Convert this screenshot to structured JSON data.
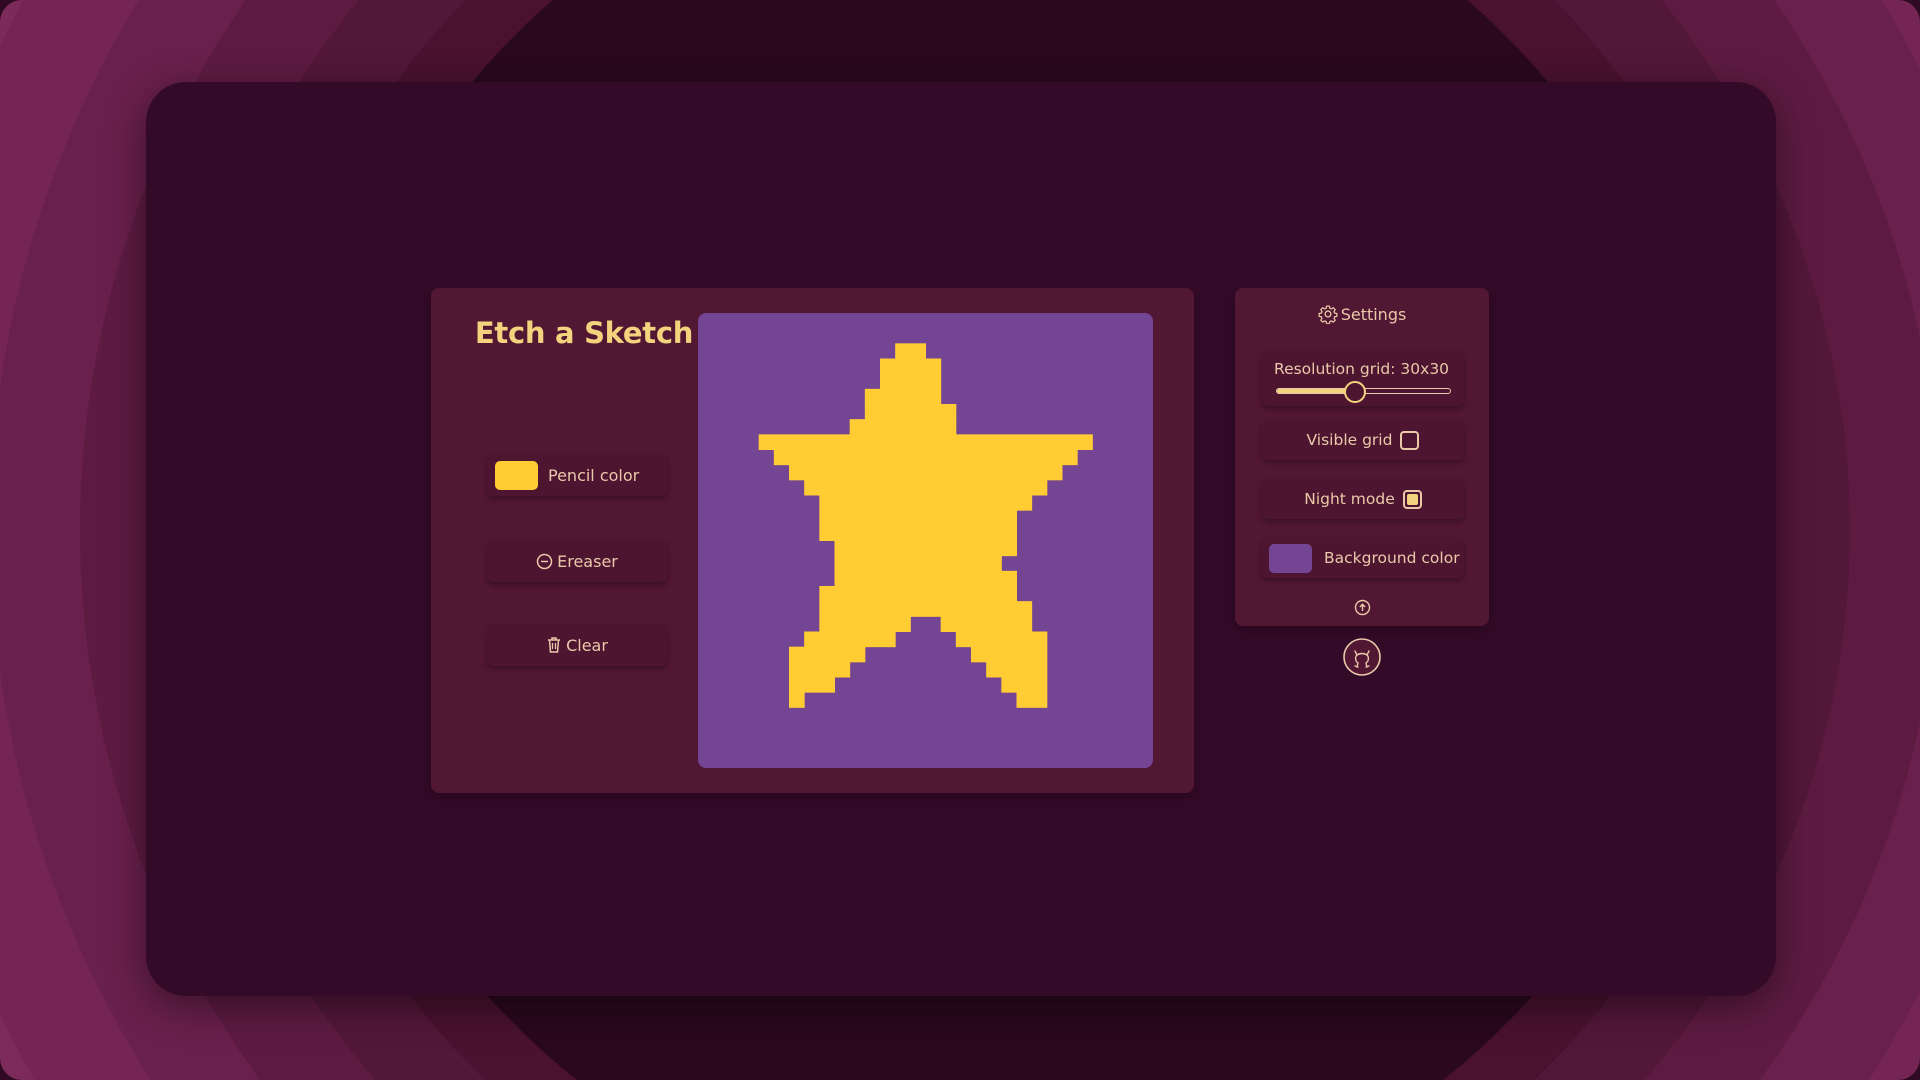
{
  "app": {
    "title": "Etch a Sketch"
  },
  "tools": {
    "pencil_label": "Pencil color",
    "eraser_label": "Ereaser",
    "clear_label": "Clear"
  },
  "settings": {
    "header": "Settings",
    "resolution_label": "Resolution grid: 30x30",
    "resolution_value": 30,
    "resolution_fraction": 0.45,
    "visible_grid_label": "Visible grid",
    "visible_grid_checked": false,
    "night_mode_label": "Night mode",
    "night_mode_checked": true,
    "background_color_label": "Background color"
  },
  "colors": {
    "pencil": "#ffcc33",
    "background": "#744593",
    "accent": "#f3d37e",
    "text": "#e9c9a9"
  },
  "icons": {
    "settings": "gear-icon",
    "eraser": "minus-circle-icon",
    "clear": "trash-icon",
    "collapse": "arrow-up-circle-icon",
    "github": "github-icon"
  },
  "canvas": {
    "grid_size": 30,
    "drawing": [
      "..........................................",
      "...........##.................",
      "..........####................",
      "..........####................",
      ".........######...............",
      ".........######...............",
      "........########..............",
      "#####################.........",
      ".###################..........",
      "..#################...........",
      "...###############............",
      "...##############.............",
      "....############..............",
      "....############..............",
      "....############..............",
      "...#############..............",
      "...##############.............",
      "...######..######.............",
      "..#####......#####............",
      "..###..........###............",
      ".###............###...........",
      ".##..............##..........."
    ]
  }
}
